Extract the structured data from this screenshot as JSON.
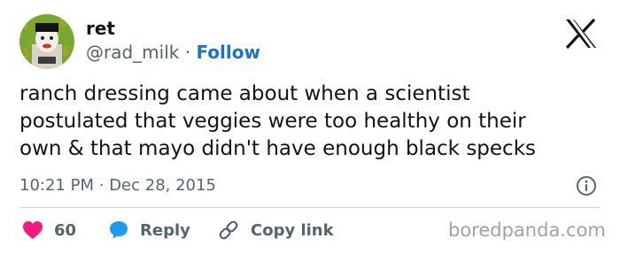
{
  "author": {
    "display_name": "ret",
    "handle": "@rad_milk",
    "separator": "·",
    "follow_label": "Follow"
  },
  "tweet": {
    "text": "ranch dressing came about when a scientist\npostulated that veggies were too healthy on their\nown & that mayo didn't have enough black specks",
    "time": "10:21 PM",
    "meta_separator": "·",
    "date": "Dec 28, 2015"
  },
  "actions": {
    "like_count": "60",
    "reply_label": "Reply",
    "copy_label": "Copy link"
  },
  "watermark": "boredpanda.com",
  "colors": {
    "like": "#f91880",
    "reply": "#1d9bf0",
    "follow": "#1d73c9",
    "muted": "#536471"
  }
}
